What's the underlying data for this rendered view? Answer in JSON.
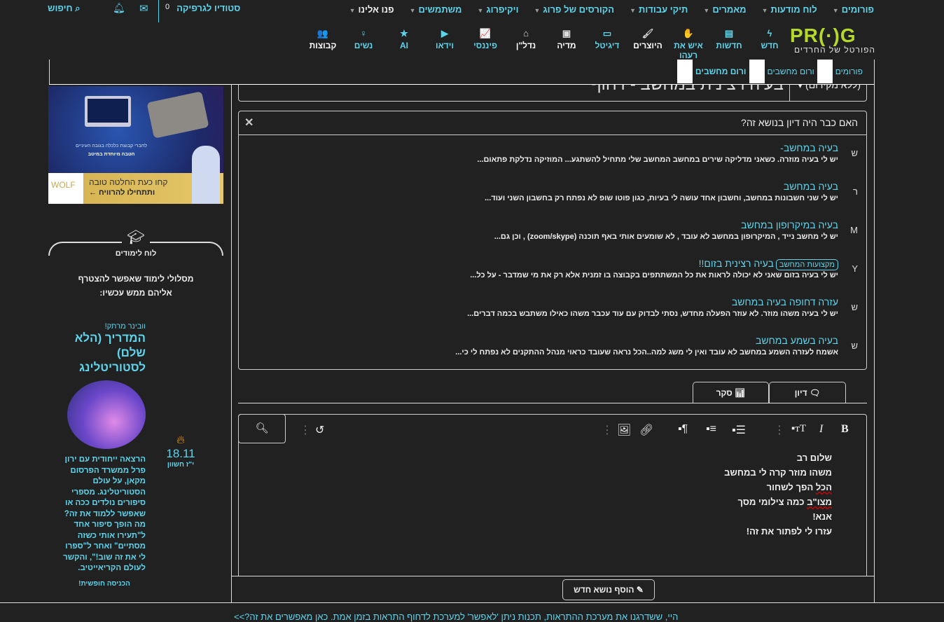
{
  "topnav": {
    "items": [
      "פורומים",
      "לוח מודעות",
      "מאמרים",
      "תיקי עבודות",
      "הקורסים של פרוג",
      "ויקיפרוג",
      "משתמשים",
      "פנו אלינו"
    ],
    "studio": "סטודיו לגרפיקה",
    "studio_count": "0",
    "search": "חיפוש"
  },
  "logo": {
    "text": "PR(·)G",
    "tagline": "הפורטל של החרדים"
  },
  "iconnav": [
    {
      "label": "חדש",
      "icon": "bolt-icon",
      "glyph": "ϟ"
    },
    {
      "label": "חדשות",
      "icon": "newspaper-icon",
      "glyph": "▤"
    },
    {
      "label": "איש את רעהו",
      "icon": "handshake-icon",
      "glyph": "✋"
    },
    {
      "label": "היוצרים",
      "icon": "brush-icon",
      "glyph": "🖌"
    },
    {
      "label": "דיגיטל",
      "icon": "monitor-icon",
      "glyph": "▭"
    },
    {
      "label": "מדיה",
      "icon": "images-icon",
      "glyph": "▣"
    },
    {
      "label": "נדל\"ן",
      "icon": "house-icon",
      "glyph": "⌂"
    },
    {
      "label": "פיננסי",
      "icon": "chart-icon",
      "glyph": "📈"
    },
    {
      "label": "וידאו",
      "icon": "play-icon",
      "glyph": "▶"
    },
    {
      "label": "AI",
      "icon": "star-icon",
      "glyph": "★"
    },
    {
      "label": "נשים",
      "icon": "woman-icon",
      "glyph": "♀"
    },
    {
      "label": "קבוצות",
      "icon": "users-icon",
      "glyph": "👥"
    }
  ],
  "breadcrumb": [
    "פורומים",
    "ורום מחשבים",
    "ורום מחשבים"
  ],
  "thread": {
    "prefix": "(ללא מקידום)",
    "title": "בעיה רצינית במחשב - דחוף"
  },
  "similar": {
    "heading": "האם כבר היה דיון בנושא זה?",
    "items": [
      {
        "avatar": "ש",
        "title": "בעיה במחשב-",
        "snippet": "יש לי בעיה מוזרה. כשאני מדליקה שירים במחשב המחשב שלי מתחיל להשתגע... המוזיקה נדלקת פתאום..."
      },
      {
        "avatar": "ר",
        "title": "בעיה במחשב",
        "snippet": "יש לי שני חשבונות במחשב, וחשבון אחד עושה לי בעיות, כגון פוטו שופ לא נפתח רק בחשבון השני ועוד..."
      },
      {
        "avatar": "M",
        "title": "בעיה במיקרופון במחשב",
        "snippet": "יש לי מחשב נייד , המיקרופון במחשב לא עובד , לא שומעים אותי באף תוכנה (zoom/skype) , וכן גם..."
      },
      {
        "avatar": "Y",
        "prefix": "מקצועות המחשב",
        "title": "בעיה רצינית בזום!!",
        "snippet": "יש לי בעיה בזום שאני לא יכולה לראות את כל המשתתפים בקבוצה בו זמנית אלא רק את מי שמדבר - על כל..."
      },
      {
        "avatar": "ש",
        "title": "עזרה דחופה בעיה במחשב",
        "snippet": "יש לי בעיה משהו מוזר. לא עוזר הפעלה מחדש, נסתי לבדוק עם עוד עכבר משהו כאילו משתבש בכמה דברים..."
      },
      {
        "avatar": "ש",
        "title": "בעיה בשמע במחשב",
        "snippet": "אשמח לעזרה השמע במחשב לא עובד ואין לי משג למה..הכל נראה שעובד כראוי מנהל ההתקנים לא נפתח לי כי..."
      }
    ]
  },
  "tabs": {
    "discussion": "דיון",
    "poll": "סקר"
  },
  "editor": {
    "lines": [
      "שלום רב",
      "משהו מוזר קרה לי במחשב",
      "הכל הפך לשחור",
      "מצו\"ב כמה צילומי מסך",
      "אנא!",
      "עזרו לי לפתור את זה!"
    ]
  },
  "submit": "הוסף נושא חדש",
  "footer": "היי, ששדרגנו את מערכת ההתראות, תכנות ניתן 'לאפשר' למערכת לדחוף התראות בזמן אמת. כאן מאפשרים את זה?>>",
  "ad": {
    "line1": "קחו כעת החלטה טובה",
    "line2": "ותתחילו להרוויח ←",
    "sub": "לחברי קבוצת כלכלה בגובה העיניים",
    "sub2": "הטבה מיוחדת במיטב",
    "brand": "WOLF"
  },
  "learning": {
    "title": "לוח לימודים",
    "desc": "מסלולי לימוד שאפשר להצטרף אליהם ממש עכשיו:"
  },
  "webinar": {
    "kicker": "וובינר מרתק!",
    "title": "המדריך (הלא שלם) לסטוריטלינג",
    "body": "הרצאה ייחודית עם ירון פרל ממשרד הפרסום מקאן, על עולם הסטוריטלינג. מספרי סיפורים נולדים ככה או שאפשר ללמוד את זה? מה הופך סיפור אחד ל\"תעירו אותי כשזה מסתיים\" ואחר ל\"ספרו לי את זה שוב!\", והקשר לעולם הקריאייטיב.",
    "cta": "הכניסה חופשית!",
    "date": "18.11",
    "hebdate": "י\"ז חשוון"
  }
}
